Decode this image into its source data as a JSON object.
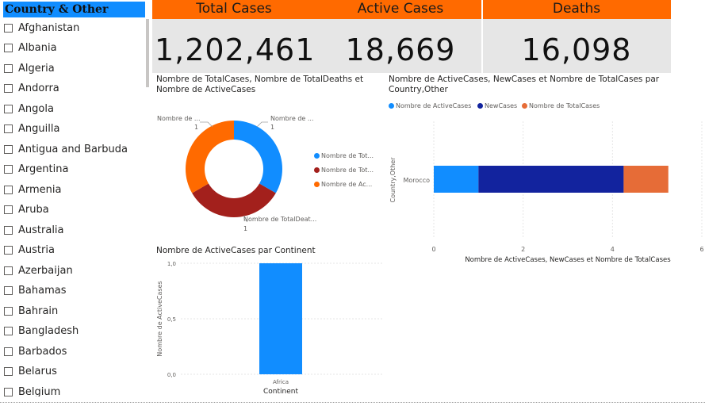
{
  "slicer": {
    "title": "Country & Other",
    "items": [
      "Afghanistan",
      "Albania",
      "Algeria",
      "Andorra",
      "Angola",
      "Anguilla",
      "Antigua and Barbuda",
      "Argentina",
      "Armenia",
      "Aruba",
      "Australia",
      "Austria",
      "Azerbaijan",
      "Bahamas",
      "Bahrain",
      "Bangladesh",
      "Barbados",
      "Belarus",
      "Belgium"
    ]
  },
  "kpis": [
    {
      "title": "Total Cases",
      "value": "1,202,461"
    },
    {
      "title": "Active Cases",
      "value": "18,669"
    },
    {
      "title": "Deaths",
      "value": "16,098"
    }
  ],
  "donut": {
    "title_line1": "Nombre de TotalCases, Nombre de TotalDeaths et",
    "title_line2": "Nombre de ActiveCases",
    "labels": [
      {
        "text": "Nombre de ...",
        "value": "1"
      },
      {
        "text": "Nombre de ...",
        "value": "1"
      },
      {
        "text": "Nombre de TotalDeat...",
        "value": "1"
      }
    ],
    "legend": [
      "Nombre de Tot...",
      "Nombre de Tot...",
      "Nombre de Ac..."
    ],
    "colors": [
      "#118DFF",
      "#A3201C",
      "#FF6A00"
    ]
  },
  "hbar": {
    "title_line1": "Nombre de ActiveCases, NewCases et Nombre de TotalCases par",
    "title_line2": "Country,Other",
    "legend": [
      "Nombre de ActiveCases",
      "NewCases",
      "Nombre de TotalCases"
    ],
    "ylabel": "Country,Other",
    "xlabel": "Nombre de ActiveCases, NewCases et Nombre de TotalCases",
    "category": "Morocco",
    "ticks": [
      "0",
      "2",
      "4",
      "6"
    ]
  },
  "vbar": {
    "title": "Nombre de ActiveCases par Continent",
    "ylabel": "Nombre de ActiveCases",
    "xlabel": "Continent",
    "ticks": [
      "0,0",
      "0,5",
      "1,0"
    ],
    "category": "Africa"
  },
  "chart_data": [
    {
      "type": "pie",
      "title": "Nombre de TotalCases, Nombre de TotalDeaths et Nombre de ActiveCases",
      "categories": [
        "Nombre de TotalCases",
        "Nombre de TotalDeaths",
        "Nombre de ActiveCases"
      ],
      "values": [
        1,
        1,
        1
      ],
      "colors": [
        "#118DFF",
        "#A3201C",
        "#FF6A00"
      ]
    },
    {
      "type": "bar",
      "orientation": "horizontal",
      "stacked": true,
      "title": "Nombre de ActiveCases, NewCases et Nombre de TotalCases par Country,Other",
      "categories": [
        "Morocco"
      ],
      "series": [
        {
          "name": "Nombre de ActiveCases",
          "values": [
            1
          ],
          "color": "#118DFF"
        },
        {
          "name": "NewCases",
          "values": [
            3.25
          ],
          "color": "#12239E"
        },
        {
          "name": "Nombre de TotalCases",
          "values": [
            1
          ],
          "color": "#E66C37"
        }
      ],
      "xlim": [
        0,
        6
      ],
      "xlabel": "Nombre de ActiveCases, NewCases et Nombre de TotalCases",
      "ylabel": "Country,Other"
    },
    {
      "type": "bar",
      "title": "Nombre de ActiveCases par Continent",
      "categories": [
        "Africa"
      ],
      "values": [
        1.0
      ],
      "ylim": [
        0,
        1.0
      ],
      "xlabel": "Continent",
      "ylabel": "Nombre de ActiveCases",
      "color": "#118DFF"
    }
  ]
}
